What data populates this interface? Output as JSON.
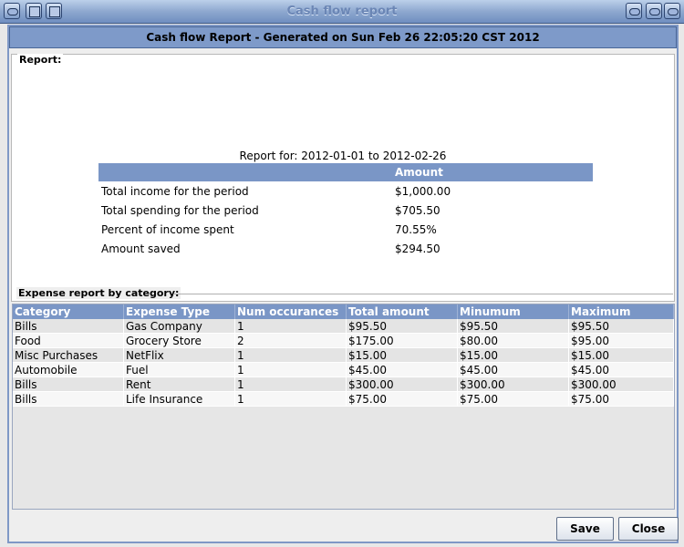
{
  "window": {
    "title": "Cash flow report",
    "header": "Cash flow Report - Generated on Sun Feb 26 22:05:20 CST 2012"
  },
  "report": {
    "legend": "Report:",
    "caption": "Report for: 2012-01-01 to 2012-02-26",
    "amount_header": "Amount",
    "rows": [
      {
        "label": "Total income for the period",
        "value": "$1,000.00"
      },
      {
        "label": "Total spending for the period",
        "value": "$705.50"
      },
      {
        "label": "Percent of income spent",
        "value": "70.55%"
      },
      {
        "label": "Amount saved",
        "value": "$294.50"
      }
    ]
  },
  "expenses": {
    "legend": "Expense report by category:",
    "columns": [
      "Category",
      "Expense Type",
      "Num occurances",
      "Total amount",
      "Minumum",
      "Maximum"
    ],
    "rows": [
      [
        "Bills",
        "Gas Company",
        "1",
        "$95.50",
        "$95.50",
        "$95.50"
      ],
      [
        "Food",
        "Grocery Store",
        "2",
        "$175.00",
        "$80.00",
        "$95.00"
      ],
      [
        "Misc Purchases",
        "NetFlix",
        "1",
        "$15.00",
        "$15.00",
        "$15.00"
      ],
      [
        "Automobile",
        "Fuel",
        "1",
        "$45.00",
        "$45.00",
        "$45.00"
      ],
      [
        "Bills",
        "Rent",
        "1",
        "$300.00",
        "$300.00",
        "$300.00"
      ],
      [
        "Bills",
        "Life Insurance",
        "1",
        "$75.00",
        "$75.00",
        "$75.00"
      ]
    ]
  },
  "buttons": {
    "save": "Save",
    "close": "Close"
  }
}
